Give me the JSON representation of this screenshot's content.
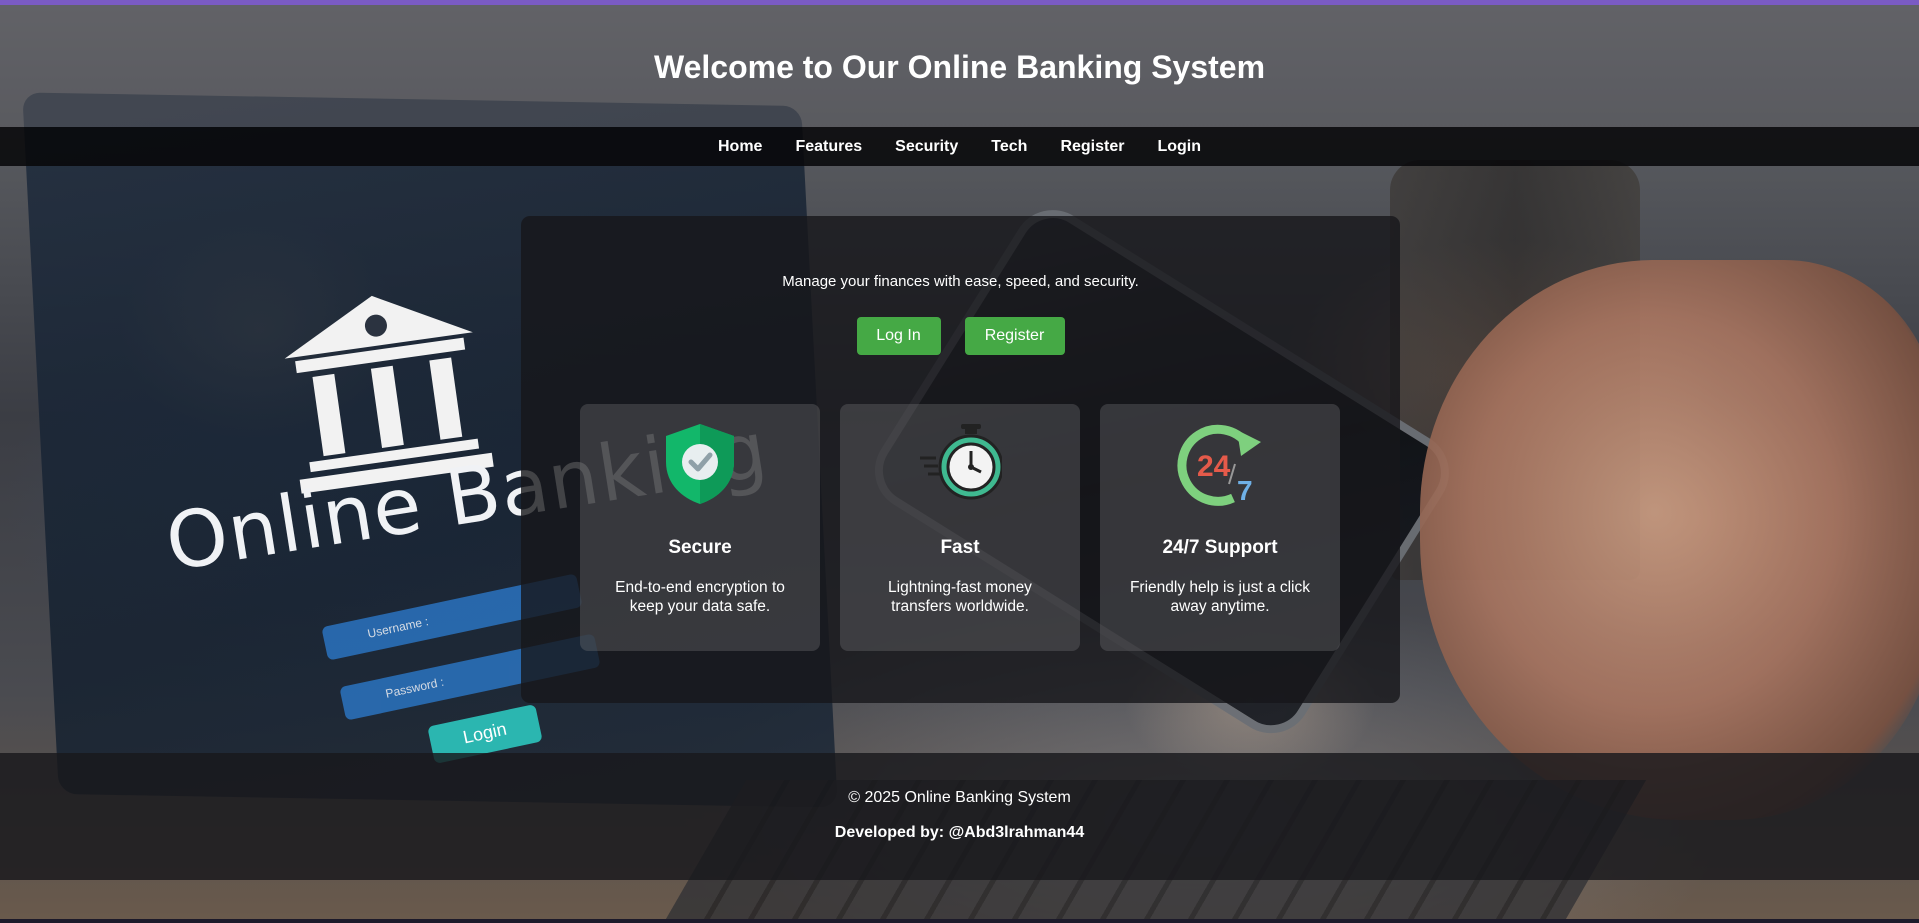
{
  "header": {
    "title": "Welcome to Our Online Banking System"
  },
  "nav": {
    "items": [
      {
        "label": "Home"
      },
      {
        "label": "Features"
      },
      {
        "label": "Security"
      },
      {
        "label": "Tech"
      },
      {
        "label": "Register"
      },
      {
        "label": "Login"
      }
    ]
  },
  "hero": {
    "tagline": "Manage your finances with ease, speed, and security.",
    "login_button": "Log In",
    "register_button": "Register",
    "button_color": "#45a945"
  },
  "features": [
    {
      "icon": "shield-check-icon",
      "title": "Secure",
      "description": "End-to-end encryption to keep your data safe."
    },
    {
      "icon": "stopwatch-icon",
      "title": "Fast",
      "description": "Lightning-fast money transfers worldwide."
    },
    {
      "icon": "support-24-7-icon",
      "title": "24/7 Support",
      "description": "Friendly help is just a click away anytime."
    }
  ],
  "background": {
    "headline": "Online Banking",
    "username_placeholder": "Username :",
    "password_placeholder": "Password :",
    "login_label": "Login"
  },
  "footer": {
    "copyright": "© 2025 Online Banking System",
    "developer": "Developed by: @Abd3lrahman44"
  },
  "colors": {
    "accent_border": "#7a5bc4",
    "nav_background": "#08080a"
  }
}
